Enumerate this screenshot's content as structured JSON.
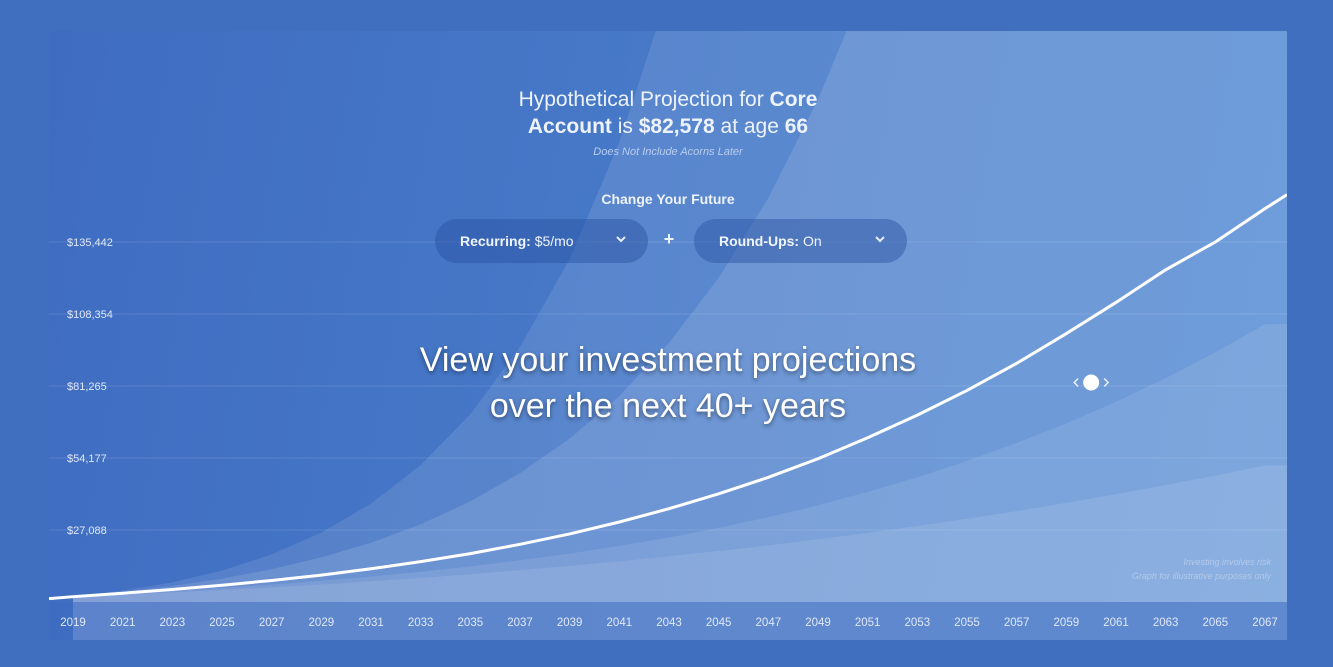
{
  "header": {
    "title_prefix": "Hypothetical Projection for",
    "title_account": "Core",
    "title_account2": "Account",
    "title_is": "is",
    "title_amount": "$82,578",
    "title_at_age": "at age",
    "title_age": "66",
    "subtitle": "Does Not Include Acorns Later"
  },
  "controls": {
    "change_label": "Change Your Future",
    "recurring_label": "Recurring:",
    "recurring_value": "$5/mo",
    "plus": "+",
    "roundups_label": "Round-Ups:",
    "roundups_value": "On"
  },
  "overlay": {
    "line1": "View your investment projections",
    "line2": "over the next 40+ years"
  },
  "disclaimer": {
    "line1": "Investing involves risk",
    "line2": "Graph for illustrative purposes only"
  },
  "icons": {
    "dropdown": "chevron-down-icon",
    "handle": "drag-handle-icon"
  },
  "colors": {
    "background": "#406fc0",
    "projection_line": "#ffffff",
    "band": "#ffffff"
  },
  "chart_data": {
    "type": "area",
    "x": [
      2019,
      2021,
      2023,
      2025,
      2027,
      2029,
      2031,
      2033,
      2035,
      2037,
      2039,
      2041,
      2043,
      2045,
      2047,
      2049,
      2051,
      2053,
      2055,
      2057,
      2059,
      2061,
      2063,
      2065,
      2067
    ],
    "y_ticks": [
      27088,
      54177,
      81265,
      108354,
      135442
    ],
    "y_tick_labels": [
      "$27,088",
      "$54,177",
      "$81,265",
      "$108,354",
      "$135,442"
    ],
    "x_tick_labels": [
      "2019",
      "2021",
      "2023",
      "2025",
      "2027",
      "2029",
      "2031",
      "2033",
      "2035",
      "2037",
      "2039",
      "2041",
      "2043",
      "2045",
      "2047",
      "2049",
      "2051",
      "2053",
      "2055",
      "2057",
      "2059",
      "2061",
      "2063",
      "2065",
      "2067"
    ],
    "ylim": [
      0,
      135442
    ],
    "xlim": [
      2019,
      2067
    ],
    "grid": true,
    "selected": {
      "x": 2060,
      "value": 82578
    },
    "series": [
      {
        "role": "projection",
        "values": [
          2000,
          3300,
          4700,
          6300,
          8100,
          10100,
          12500,
          15200,
          18200,
          21700,
          25600,
          30100,
          35100,
          40700,
          46900,
          53900,
          61800,
          70300,
          79600,
          89800,
          101000,
          112700,
          125000,
          135442,
          148000
        ]
      },
      {
        "role": "band-upper-1",
        "values": [
          2000,
          3800,
          6000,
          8800,
          12300,
          16800,
          22300,
          29200,
          37900,
          48500,
          61500,
          77500,
          97500,
          122000,
          152000,
          189000,
          234000,
          290000,
          360000,
          445000,
          550000,
          680000,
          840000,
          1040000,
          1280000
        ]
      },
      {
        "role": "band-upper-2",
        "values": [
          2000,
          4300,
          7400,
          11800,
          17900,
          26100,
          37000,
          51500,
          70600,
          96000,
          129000,
          173000,
          230000,
          305000,
          403000,
          531000,
          700000,
          920000,
          1210000,
          1590000,
          2090000,
          2750000,
          3620000,
          4760000,
          6260000
        ]
      },
      {
        "role": "band-lower-1",
        "values": [
          2000,
          3000,
          4100,
          5300,
          6600,
          8000,
          9600,
          11400,
          13400,
          15700,
          18200,
          21100,
          24300,
          27900,
          31900,
          36400,
          41400,
          46900,
          53100,
          59800,
          67200,
          75300,
          84200,
          93900,
          104500
        ]
      },
      {
        "role": "band-lower-2",
        "values": [
          2000,
          2800,
          3600,
          4500,
          5500,
          6600,
          7800,
          9100,
          10500,
          12000,
          13600,
          15300,
          17200,
          19200,
          21300,
          23600,
          26000,
          28600,
          31300,
          34200,
          37300,
          40600,
          44000,
          47600,
          51400
        ]
      }
    ]
  }
}
